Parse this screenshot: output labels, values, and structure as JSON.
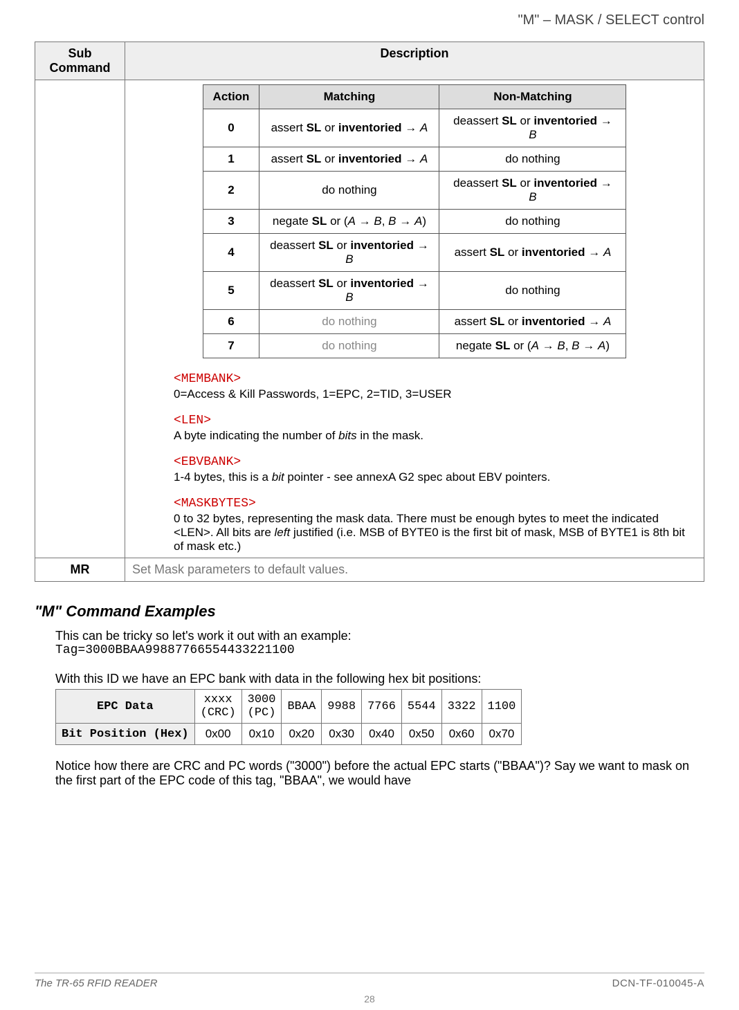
{
  "header": {
    "title": "\"M\" – MASK / SELECT control"
  },
  "main_table": {
    "col1": "Sub Command",
    "col2": "Description",
    "action_table": {
      "headers": [
        "Action",
        "Matching",
        "Non-Matching"
      ],
      "rows": [
        {
          "a": "0",
          "m": "assert SL or inventoried → A",
          "n": "deassert SL or inventoried → B"
        },
        {
          "a": "1",
          "m": "assert SL or inventoried → A",
          "n": "do nothing"
        },
        {
          "a": "2",
          "m": "do nothing",
          "n": "deassert SL or inventoried → B"
        },
        {
          "a": "3",
          "m": "negate SL or (A → B, B → A)",
          "n": "do nothing"
        },
        {
          "a": "4",
          "m": "deassert SL or inventoried → B",
          "n": "assert SL or inventoried → A"
        },
        {
          "a": "5",
          "m": "deassert SL or inventoried → B",
          "n": "do nothing"
        },
        {
          "a": "6",
          "m": "do nothing",
          "n": "assert SL or inventoried → A",
          "mgray": true
        },
        {
          "a": "7",
          "m": "do nothing",
          "n": "negate SL or (A → B, B → A)",
          "mgray": true
        }
      ]
    },
    "params": [
      {
        "tag": "<MEMBANK>",
        "desc": "0=Access & Kill Passwords, 1=EPC, 2=TID, 3=USER"
      },
      {
        "tag": "<LEN>",
        "desc": "A byte indicating the number of bits in the mask."
      },
      {
        "tag": "<EBVBANK>",
        "desc": "1-4 bytes, this is a bit pointer - see annexA G2 spec about EBV pointers."
      },
      {
        "tag": "<MASKBYTES>",
        "desc": "0 to 32 bytes, representing the mask data. There must be enough bytes to meet the indicated <LEN>. All bits are left justified (i.e. MSB of BYTE0 is the first bit of mask, MSB of BYTE1 is 8th bit of mask etc.)"
      }
    ],
    "mr_row": {
      "cmd": "MR",
      "desc": "Set Mask parameters to default values."
    }
  },
  "examples": {
    "title": "\"M\" Command Examples",
    "intro": "This can be tricky so let's work it out with an example:",
    "tag_line": "Tag=3000BBAA99887766554433221100",
    "sentence2": "With this ID we have an EPC bank with data in the following hex bit positions:",
    "epc_table": {
      "row1_label": "EPC Data",
      "row1": [
        "xxxx (CRC)",
        "3000 (PC)",
        "BBAA",
        "9988",
        "7766",
        "5544",
        "3322",
        "1100"
      ],
      "row2_label": "Bit Position (Hex)",
      "row2": [
        "0x00",
        "0x10",
        "0x20",
        "0x30",
        "0x40",
        "0x50",
        "0x60",
        "0x70"
      ]
    },
    "trailing": "Notice how there are CRC and PC words (\"3000\") before the actual EPC starts (\"BBAA\")? Say we want to mask on the first part of the EPC code of this tag, \"BBAA\", we would have"
  },
  "footer": {
    "left": "The TR-65 RFID READER",
    "right": "DCN-TF-010045-A",
    "page": "28"
  }
}
